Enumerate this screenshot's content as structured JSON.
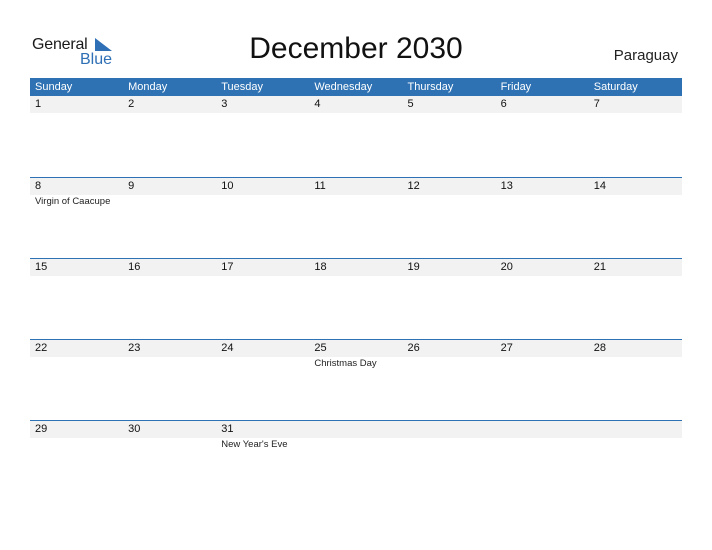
{
  "logo": {
    "general": "General",
    "blue": "Blue"
  },
  "title": "December 2030",
  "country": "Paraguay",
  "colors": {
    "accent": "#2e72b3",
    "row_bg": "#f2f2f2"
  },
  "weekdays": [
    "Sunday",
    "Monday",
    "Tuesday",
    "Wednesday",
    "Thursday",
    "Friday",
    "Saturday"
  ],
  "weeks": [
    {
      "days": [
        "1",
        "2",
        "3",
        "4",
        "5",
        "6",
        "7"
      ],
      "holidays": [
        "",
        "",
        "",
        "",
        "",
        "",
        ""
      ]
    },
    {
      "days": [
        "8",
        "9",
        "10",
        "11",
        "12",
        "13",
        "14"
      ],
      "holidays": [
        "Virgin of Caacupe",
        "",
        "",
        "",
        "",
        "",
        ""
      ]
    },
    {
      "days": [
        "15",
        "16",
        "17",
        "18",
        "19",
        "20",
        "21"
      ],
      "holidays": [
        "",
        "",
        "",
        "",
        "",
        "",
        ""
      ]
    },
    {
      "days": [
        "22",
        "23",
        "24",
        "25",
        "26",
        "27",
        "28"
      ],
      "holidays": [
        "",
        "",
        "",
        "Christmas Day",
        "",
        "",
        ""
      ]
    },
    {
      "days": [
        "29",
        "30",
        "31",
        "",
        "",
        "",
        ""
      ],
      "holidays": [
        "",
        "",
        "New Year's Eve",
        "",
        "",
        "",
        ""
      ]
    }
  ]
}
